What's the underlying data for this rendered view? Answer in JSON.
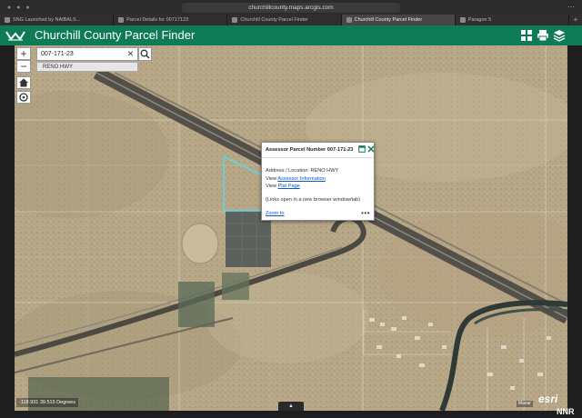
{
  "browser": {
    "url": "churchillcounty.maps.arcgis.com",
    "tabs": [
      {
        "label": "SNG Launched by NAIBALS...",
        "active": false
      },
      {
        "label": "Parcel Details for 00717123",
        "active": false
      },
      {
        "label": "Churchill County Parcel Finder",
        "active": false
      },
      {
        "label": "Churchill County Parcel Finder",
        "active": true
      },
      {
        "label": "Paragon 5",
        "active": false
      }
    ]
  },
  "app": {
    "title": "Churchill County Parcel Finder",
    "accent": "#0f7b56"
  },
  "map": {
    "zoom_in": "+",
    "zoom_out": "−",
    "search": {
      "value": "007-171-23",
      "suggestion": "RENO HWY"
    },
    "popup": {
      "title": "Assessor Parcel Number 007-171-23",
      "address_prefix": "Address / Location: ",
      "address_value": "RENO HWY",
      "view_label": "View ",
      "assessor_link": "Assessor Information",
      "plat_link": "Plat Page",
      "note": "(Links open in a new browser window/tab)",
      "zoom_to": "Zoom to",
      "more": "•••"
    },
    "coordinates": "-118.931 39.515 Degrees",
    "attribution": "Maxar",
    "logo_text": "esri",
    "expand_handle": "▲"
  },
  "watermark": "NNR"
}
